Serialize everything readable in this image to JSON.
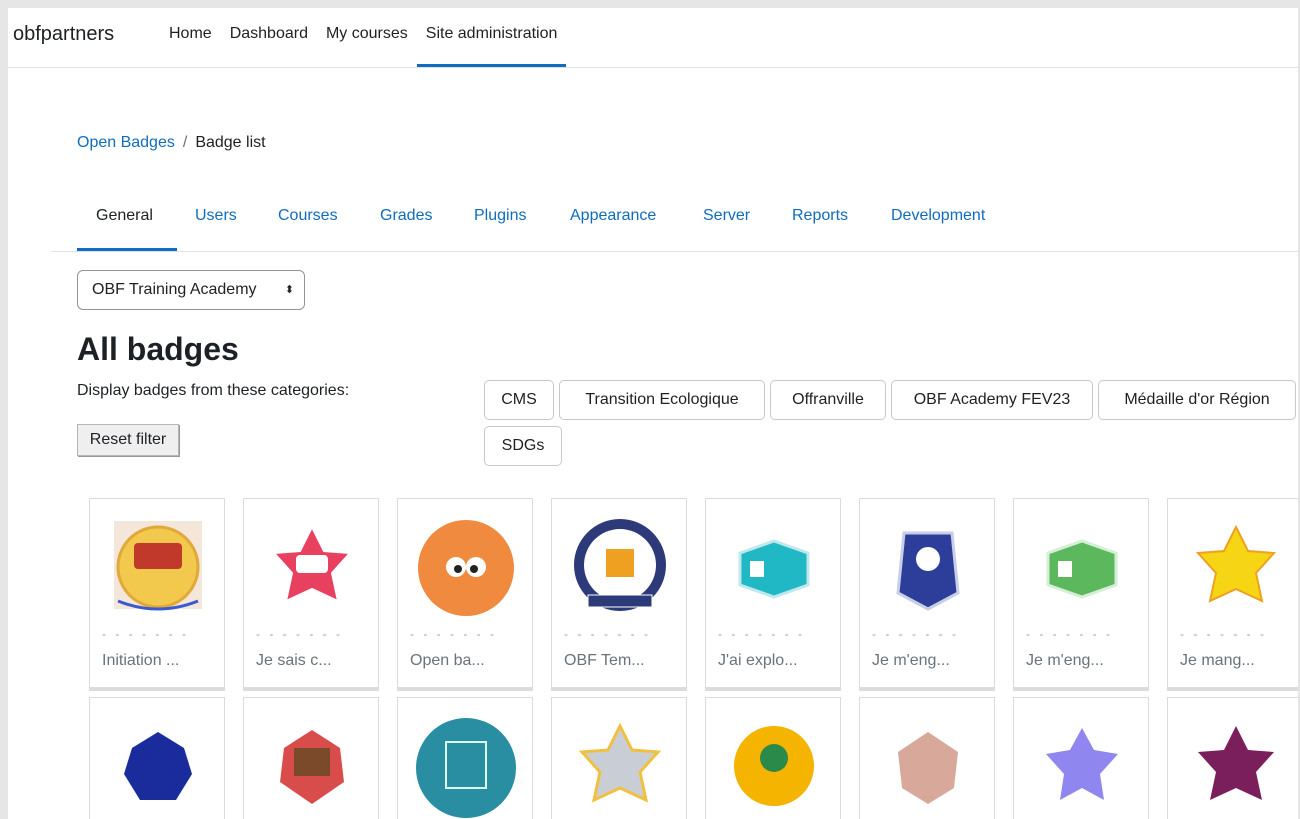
{
  "navbar": {
    "brand": "obfpartners",
    "items": [
      "Home",
      "Dashboard",
      "My courses",
      "Site administration"
    ]
  },
  "breadcrumb": {
    "parent": "Open Badges",
    "separator": "/",
    "current": "Badge list"
  },
  "tabs": [
    "General",
    "Users",
    "Courses",
    "Grades",
    "Plugins",
    "Appearance",
    "Server",
    "Reports",
    "Development"
  ],
  "select": {
    "value": "OBF Training Academy",
    "caret": "⬍"
  },
  "page_title": "All badges",
  "filter": {
    "label": "Display badges from these categories:",
    "reset_label": "Reset filter",
    "categories": [
      "CMS",
      "Transition Ecologique",
      "Offranville",
      "OBF Academy FEV23",
      "Médaille d'or Région",
      "SDGs"
    ]
  },
  "badges": {
    "row1": [
      {
        "name": "Initiation ...",
        "color": "#f2c94c"
      },
      {
        "name": "Je sais c...",
        "color": "#e8415f"
      },
      {
        "name": "Open ba...",
        "color": "#ef8a3e"
      },
      {
        "name": "OBF Tem...",
        "color": "#2d3a7a"
      },
      {
        "name": "J'ai explo...",
        "color": "#1fb8c4"
      },
      {
        "name": "Je m'eng...",
        "color": "#2c3e9a"
      },
      {
        "name": "Je m'eng...",
        "color": "#5cb85c"
      },
      {
        "name": "Je mang...",
        "color": "#f5d514"
      }
    ],
    "row2": [
      {
        "color": "#1a2b9c"
      },
      {
        "color": "#d84c4c"
      },
      {
        "color": "#2a8ea3"
      },
      {
        "color": "#c9ced6"
      },
      {
        "color": "#f5b400"
      },
      {
        "color": "#d8a89a"
      },
      {
        "color": "#8f86f0"
      },
      {
        "color": "#7a1f5c"
      }
    ],
    "dashes": "- - - - - - -"
  }
}
